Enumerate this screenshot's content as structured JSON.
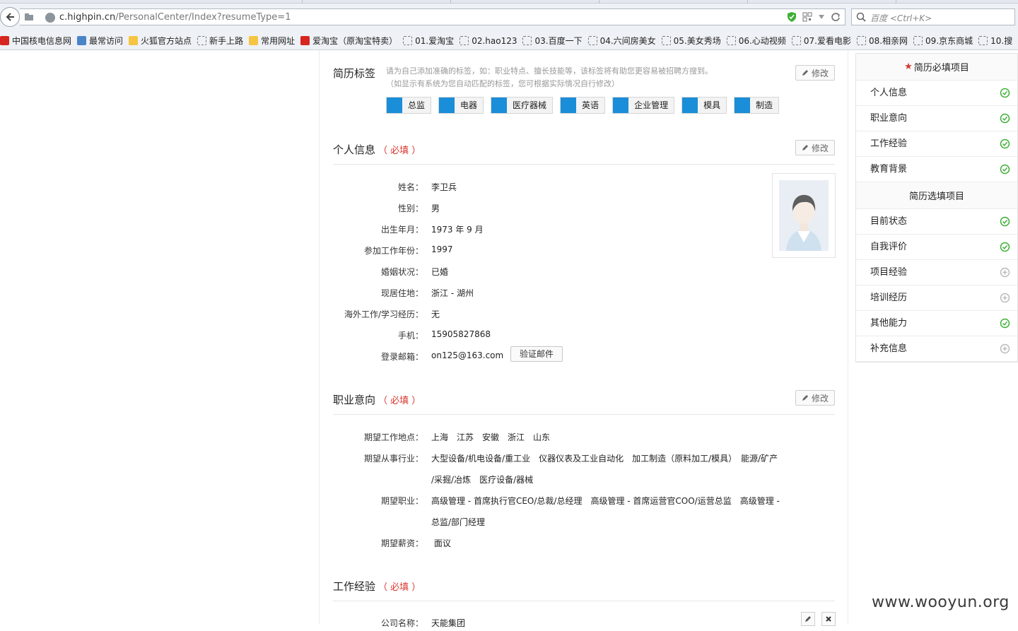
{
  "browser": {
    "url_host": "c.highpin.cn",
    "url_path": "/PersonalCenter/Index?resumeType=1",
    "search_placeholder": "百度 <Ctrl+K>",
    "bookmarks": [
      {
        "label": "中国核电信息网",
        "icon": "red"
      },
      {
        "label": "最常访问",
        "icon": "blue"
      },
      {
        "label": "火狐官方站点",
        "icon": "folder"
      },
      {
        "label": "新手上路",
        "icon": "dash"
      },
      {
        "label": "常用网址",
        "icon": "folder"
      },
      {
        "label": "爱淘宝（原淘宝特卖）",
        "icon": "red"
      },
      {
        "label": "01.爱淘宝",
        "icon": "dash"
      },
      {
        "label": "02.hao123",
        "icon": "dash"
      },
      {
        "label": "03.百度一下",
        "icon": "dash"
      },
      {
        "label": "04.六间房美女",
        "icon": "dash"
      },
      {
        "label": "05.美女秀场",
        "icon": "dash"
      },
      {
        "label": "06.心动视频",
        "icon": "dash"
      },
      {
        "label": "07.爱看电影",
        "icon": "dash"
      },
      {
        "label": "08.相亲网",
        "icon": "dash"
      },
      {
        "label": "09.京东商城",
        "icon": "dash"
      },
      {
        "label": "10.搜",
        "icon": "dash"
      }
    ]
  },
  "resume_tags": {
    "title": "简历标签",
    "hint_line1": "请为自己添加准确的标签，如：职业特点、擅长技能等，该标签将有助您更容易被招聘方搜到。",
    "hint_line2": "（如显示有系统为您自动匹配的标签，您可根据实际情况自行修改）",
    "edit_label": "修改",
    "tags": [
      "总监",
      "电器",
      "医疗器械",
      "英语",
      "企业管理",
      "模具",
      "制造"
    ]
  },
  "personal_info": {
    "title": "个人信息",
    "required": "（ 必填 ）",
    "edit_label": "修改",
    "fields": [
      {
        "label": "姓名：",
        "value": "李卫兵"
      },
      {
        "label": "性别：",
        "value": "男"
      },
      {
        "label": "出生年月：",
        "value": "1973 年 9 月"
      },
      {
        "label": "参加工作年份：",
        "value": "1997"
      },
      {
        "label": "婚姻状况：",
        "value": "已婚"
      },
      {
        "label": "现居住地：",
        "value": "浙江 - 湖州"
      },
      {
        "label": "海外工作/学习经历：",
        "value": "无"
      },
      {
        "label": "手机：",
        "value": "15905827868"
      },
      {
        "label": "登录邮箱：",
        "value": "on125@163.com"
      }
    ],
    "verify_button": "验证邮件"
  },
  "career_intent": {
    "title": "职业意向",
    "required": "（ 必填 ）",
    "edit_label": "修改",
    "location_label": "期望工作地点：",
    "location_value": "上海　江苏　安徽　浙江　山东",
    "industry_label": "期望从事行业：",
    "industry_line1": "大型设备/机电设备/重工业　仪器仪表及工业自动化　加工制造（原料加工/模具）　能源/矿产",
    "industry_line2": "/采掘/冶炼　医疗设备/器械",
    "position_label": "期望职业：",
    "position_line1": "高级管理 - 首席执行官CEO/总裁/总经理　高级管理 - 首席运营官COO/运营总监　高级管理 -",
    "position_line2": "总监/部门经理",
    "salary_label": "期望薪资：",
    "salary_value": " 面议"
  },
  "work_experience": {
    "title": "工作经验",
    "required": "（ 必填 ）",
    "company_label": "公司名称：",
    "company_value": "天能集团"
  },
  "sidebar": {
    "required_title": "简历必填项目",
    "required_items": [
      {
        "label": "个人信息",
        "status": "done"
      },
      {
        "label": "职业意向",
        "status": "done"
      },
      {
        "label": "工作经验",
        "status": "done"
      },
      {
        "label": "教育背景",
        "status": "done"
      }
    ],
    "optional_title": "简历选填项目",
    "optional_items": [
      {
        "label": "目前状态",
        "status": "done"
      },
      {
        "label": "自我评价",
        "status": "done"
      },
      {
        "label": "项目经验",
        "status": "add"
      },
      {
        "label": "培训经历",
        "status": "add"
      },
      {
        "label": "其他能力",
        "status": "done"
      },
      {
        "label": "补充信息",
        "status": "add"
      }
    ]
  },
  "colors": {
    "accent_blue": "#1a8ed8",
    "required_red": "#d9362e",
    "done_green": "#3db035"
  },
  "watermark": "www.wooyun.org"
}
